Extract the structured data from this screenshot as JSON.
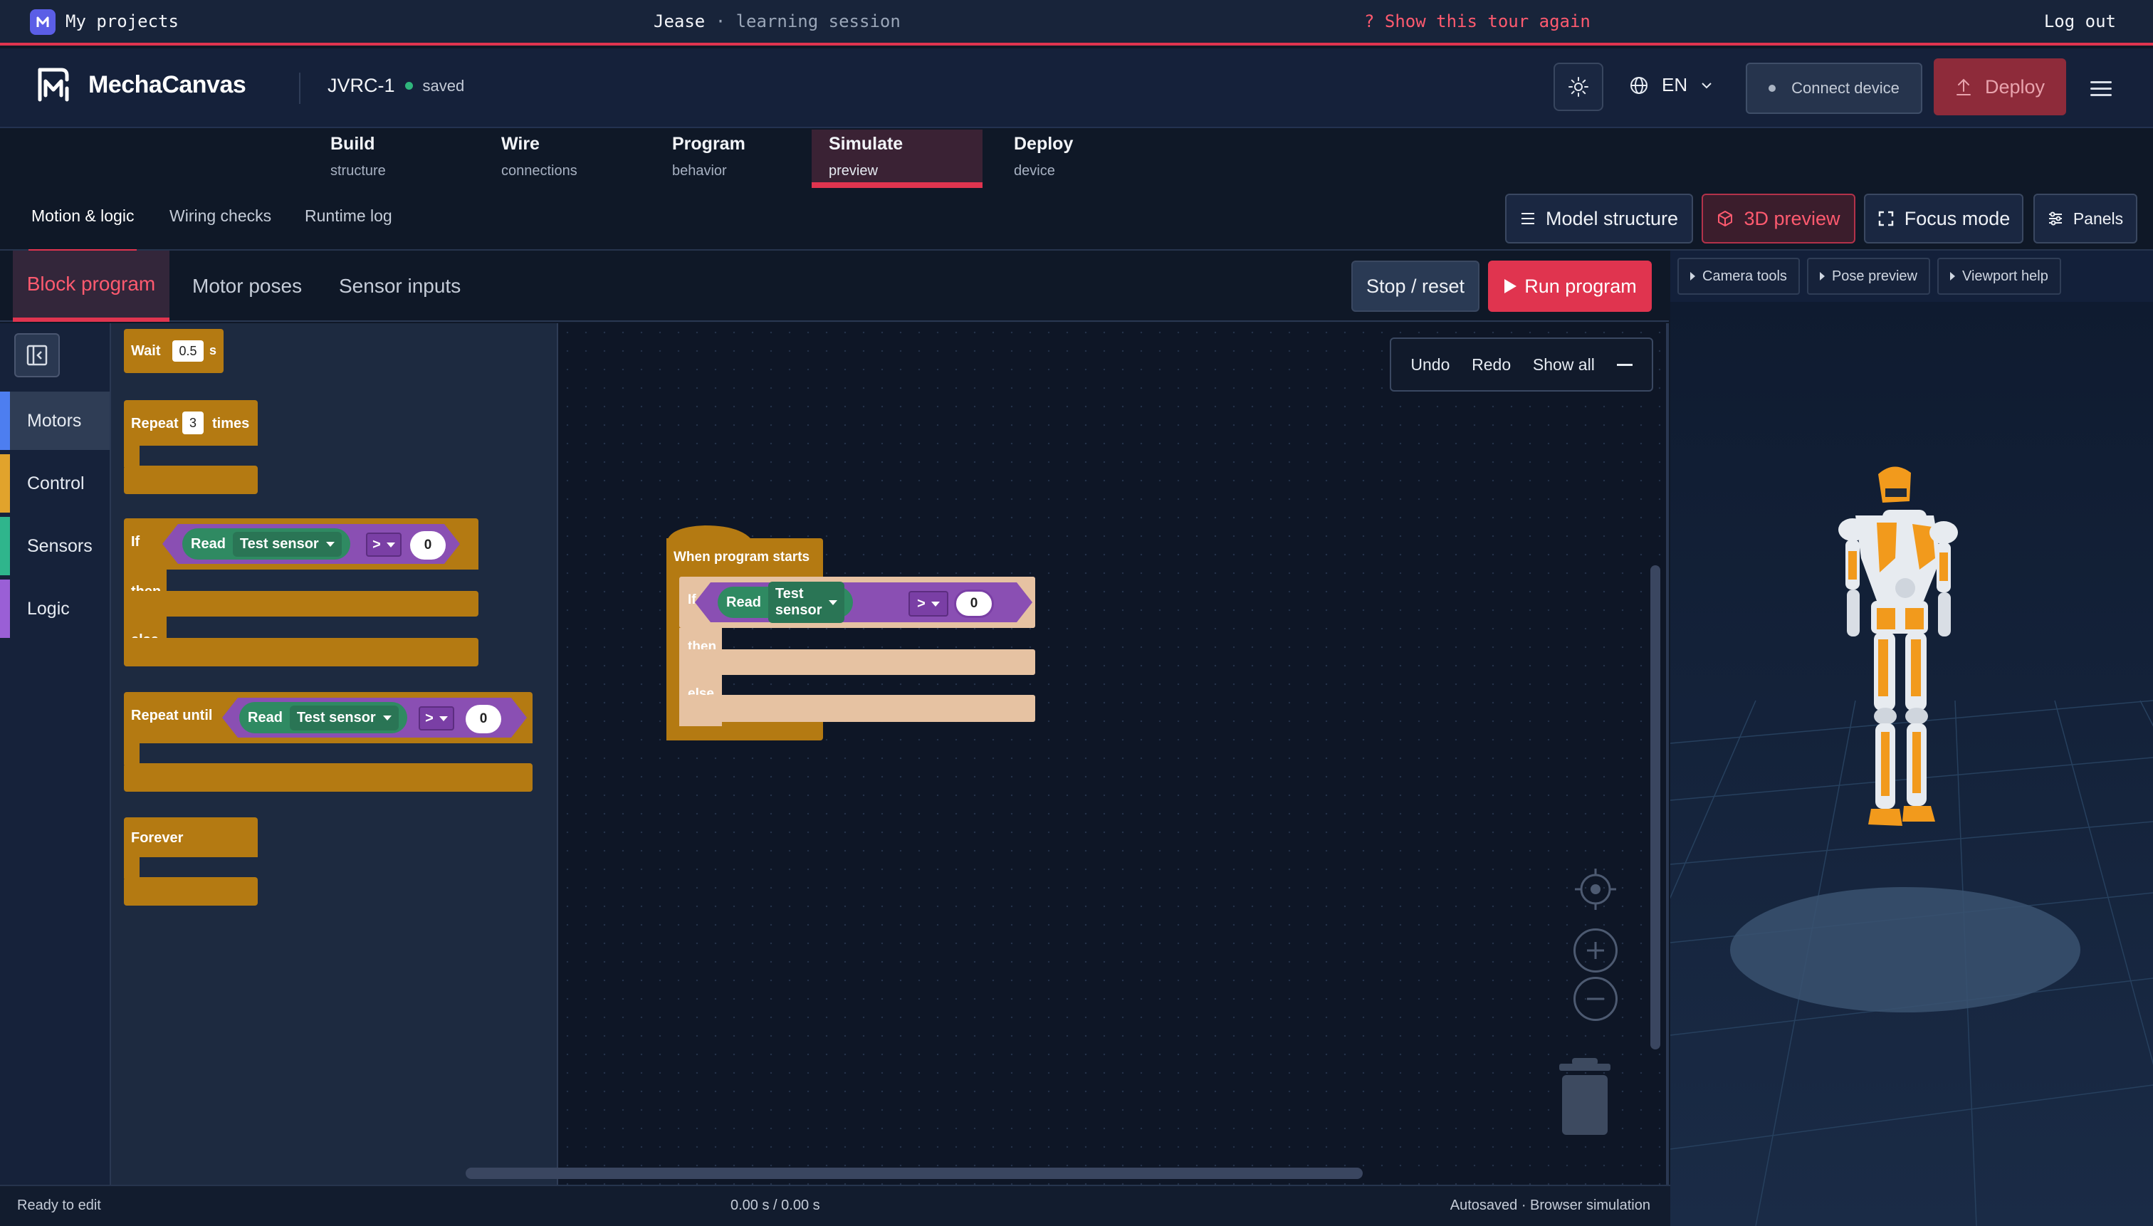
{
  "topbar": {
    "my_projects": "My projects",
    "user": "Jease",
    "separator": "·",
    "session": "learning session",
    "tour": "? Show this tour again",
    "logout": "Log out"
  },
  "header": {
    "brand": "MechaCanvas",
    "project": "JVRC-1",
    "save_status": "saved",
    "language": "EN",
    "connect": "Connect device",
    "deploy": "Deploy"
  },
  "stages": [
    {
      "title": "Build",
      "sub": "structure"
    },
    {
      "title": "Wire",
      "sub": "connections"
    },
    {
      "title": "Program",
      "sub": "behavior"
    },
    {
      "title": "Simulate",
      "sub": "preview"
    },
    {
      "title": "Deploy",
      "sub": "device"
    }
  ],
  "subtabs": [
    "Motion & logic",
    "Wiring checks",
    "Runtime log"
  ],
  "view_buttons": {
    "model_structure": "Model structure",
    "preview_3d": "3D preview",
    "focus": "Focus mode",
    "panels": "Panels"
  },
  "panel_tabs": [
    "Block program",
    "Motor poses",
    "Sensor inputs"
  ],
  "actions": {
    "stop": "Stop / reset",
    "run": "Run program"
  },
  "categories": [
    {
      "label": "Motors",
      "color": "#4d7ef0"
    },
    {
      "label": "Control",
      "color": "#e1a32c"
    },
    {
      "label": "Sensors",
      "color": "#2fb58c"
    },
    {
      "label": "Logic",
      "color": "#9a5fd6"
    }
  ],
  "flyout": {
    "wait": {
      "label": "Wait",
      "value": "0.5",
      "unit": "s"
    },
    "repeat": {
      "label": "Repeat",
      "value": "3",
      "unit": "times"
    },
    "ifelse": {
      "if": "If",
      "then": "then",
      "else": "else"
    },
    "repeat_until": {
      "label": "Repeat until"
    },
    "forever": {
      "label": "Forever"
    },
    "condition": {
      "read": "Read",
      "sensor": "Test sensor",
      "op": ">",
      "value": "0"
    }
  },
  "workspace": {
    "undo": "Undo",
    "redo": "Redo",
    "show_all": "Show all",
    "hat": "When program starts",
    "if": "If",
    "then": "then",
    "else": "else",
    "condition": {
      "read": "Read",
      "sensor": "Test sensor",
      "op": ">",
      "value": "0"
    }
  },
  "viewport": {
    "camera": "Camera tools",
    "pose": "Pose preview",
    "help": "Viewport help"
  },
  "status": {
    "left": "Ready to edit",
    "time": "0.00 s / 0.00 s",
    "right": "Autosaved · Browser simulation"
  },
  "colors": {
    "accent": "#e0344f",
    "block_control": "#b47a12",
    "block_logic": "#8a4fb3",
    "block_sensor": "#2f8a62"
  }
}
